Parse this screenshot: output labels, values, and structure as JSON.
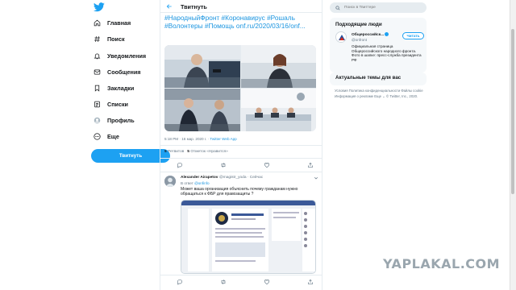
{
  "nav": {
    "items": [
      {
        "label": "Главная",
        "icon": "home-icon"
      },
      {
        "label": "Поиск",
        "icon": "hashtag-icon"
      },
      {
        "label": "Уведомления",
        "icon": "bell-icon"
      },
      {
        "label": "Сообщения",
        "icon": "mail-icon"
      },
      {
        "label": "Закладки",
        "icon": "bookmark-icon"
      },
      {
        "label": "Списки",
        "icon": "list-icon"
      },
      {
        "label": "Профиль",
        "icon": "profile-icon"
      },
      {
        "label": "Еще",
        "icon": "more-icon"
      }
    ],
    "tweet_button": "Твитнуть"
  },
  "header": {
    "title": "Твитнуть"
  },
  "tweet": {
    "text": "#НародныйФронт #Коронавирус #Рошаль #Волонтеры #Помощь onf.ru/2020/03/16/onf...",
    "timestamp": "5:18 PM · 16 мар. 2020 г. · ",
    "app": "Twitter Web App",
    "retweets_count": "5",
    "retweets_label": "Ретвитов",
    "likes_count": "5",
    "likes_label": "Отметок «Нравится»"
  },
  "reply": {
    "name": "Alexander Airapetov",
    "handle": "@magistr_yoda · Сейчас",
    "reply_to_prefix": "В ответ ",
    "reply_to_handle": "@onfinfo",
    "text": "Может ваша организация объяснить почему гражданам нужно обращаться к ФБР для правозащиты ?"
  },
  "right": {
    "search_placeholder": "Поиск в Твиттере",
    "suggestions_title": "Подходящие люди",
    "suggestion": {
      "name": "Общероссийск...",
      "handle": "@onfront",
      "follow_label": "Читать",
      "bio": "Официальная страница Общероссийского народного фронта. Фото в шапке: пресс-служба президента РФ"
    },
    "trends_title": "Актуальные темы для вас",
    "footer": "Условия   Политика конфиденциальности   Файлы cookie   Информация о рекламе   Еще ⌄   © Twitter, Inc., 2020."
  },
  "watermark": "YAPLAKAL.COM",
  "colors": {
    "accent": "#1da1f2",
    "link": "#1b95e0",
    "muted": "#657786"
  }
}
